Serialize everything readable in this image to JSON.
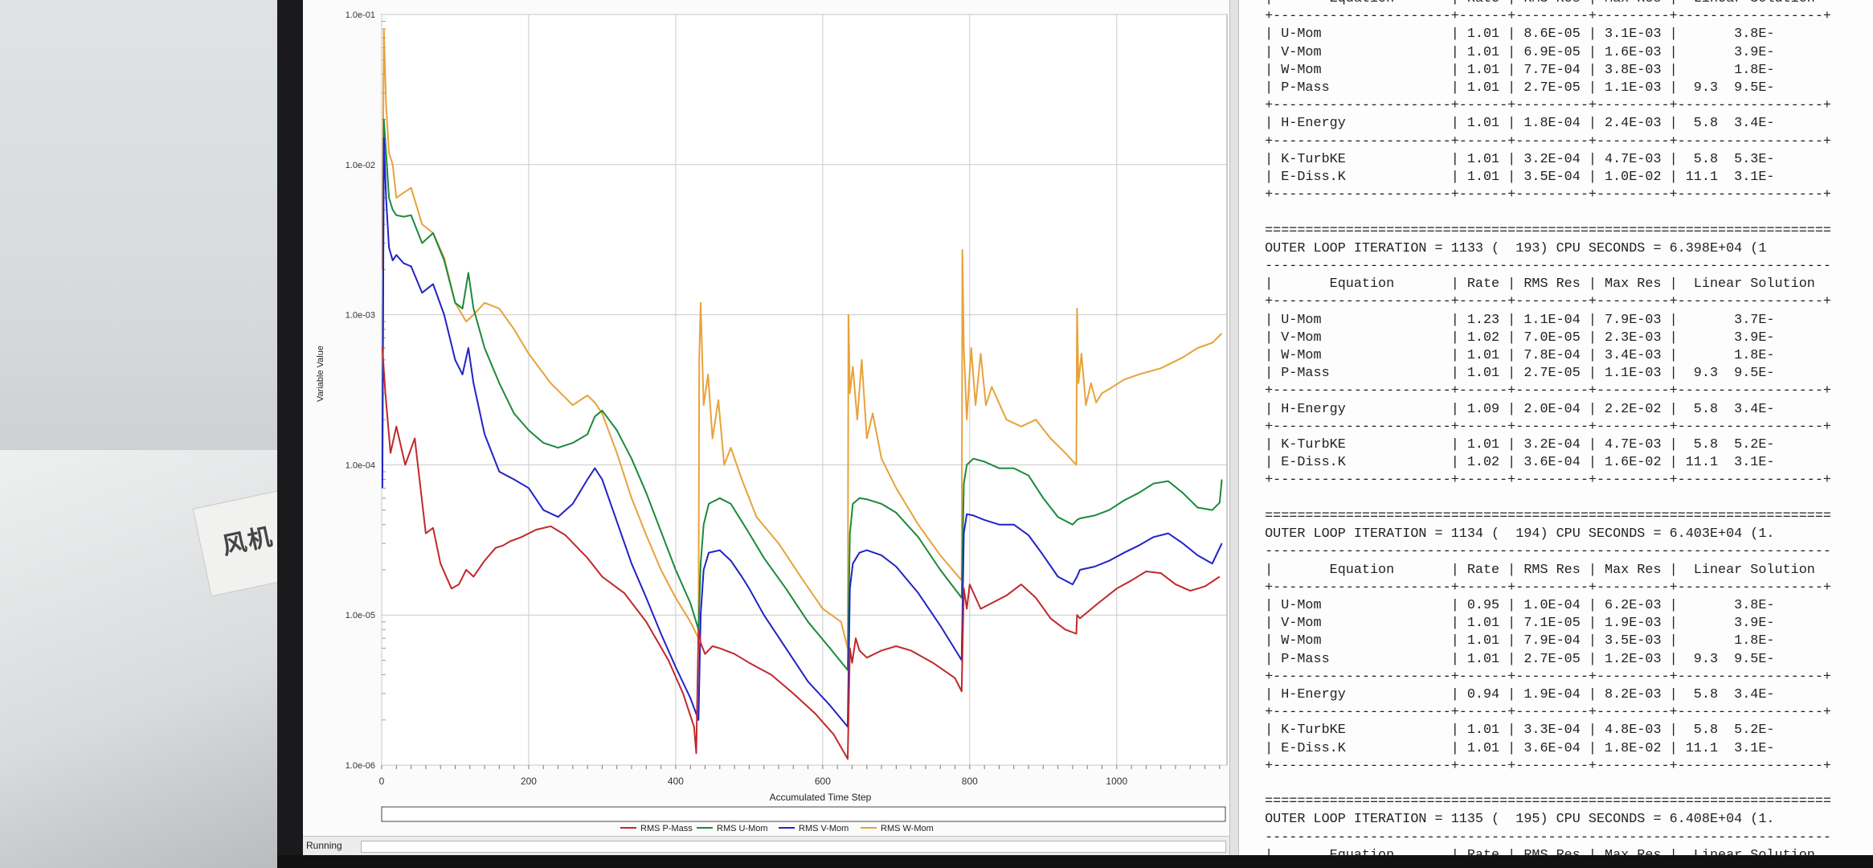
{
  "surroundings": {
    "paper_label": "风机"
  },
  "window": {
    "status": "Running"
  },
  "chart_data": {
    "type": "line",
    "xlabel": "Accumulated Time Step",
    "ylabel": "Variable Value",
    "log_y": true,
    "xlim": [
      0,
      1150
    ],
    "ylim": [
      1e-06,
      0.1
    ],
    "x_ticks": [
      "0",
      "200",
      "400",
      "600",
      "800",
      "1000"
    ],
    "y_ticks": [
      "1.0e-06",
      "1.0e-05",
      "1.0e-04",
      "1.0e-03",
      "1.0e-02",
      "1.0e-01"
    ],
    "grid": true,
    "legend_position": "bottom",
    "series": [
      {
        "name": "RMS P-Mass",
        "color": "#c0282c",
        "x": [
          1,
          5,
          12,
          20,
          32,
          45,
          60,
          70,
          80,
          95,
          105,
          115,
          125,
          140,
          155,
          165,
          175,
          190,
          210,
          230,
          250,
          280,
          300,
          330,
          360,
          390,
          410,
          425,
          428,
          431,
          434,
          440,
          450,
          460,
          480,
          500,
          530,
          560,
          590,
          615,
          634,
          637,
          640,
          645,
          650,
          660,
          680,
          700,
          720,
          750,
          780,
          789,
          792,
          796,
          800,
          815,
          830,
          850,
          870,
          890,
          910,
          930,
          945,
          946,
          950,
          975,
          1000,
          1020,
          1040,
          1060,
          1080,
          1100,
          1120,
          1140
        ],
        "y": [
          0.0006,
          0.0003,
          0.00012,
          0.00018,
          0.0001,
          0.00015,
          3.5e-05,
          3.8e-05,
          2.2e-05,
          1.5e-05,
          1.6e-05,
          2e-05,
          1.8e-05,
          2.3e-05,
          2.8e-05,
          2.9e-05,
          3.1e-05,
          3.3e-05,
          3.7e-05,
          3.9e-05,
          3.4e-05,
          2.4e-05,
          1.8e-05,
          1.4e-05,
          9e-06,
          5e-06,
          3e-06,
          1.8e-06,
          1.2e-06,
          8e-06,
          6.5e-06,
          5.5e-06,
          6.2e-06,
          6e-06,
          5.5e-06,
          4.8e-06,
          4e-06,
          3e-06,
          2.2e-06,
          1.6e-06,
          1.1e-06,
          6e-06,
          4.8e-06,
          7e-06,
          5.8e-06,
          5.2e-06,
          5.8e-06,
          6.2e-06,
          5.8e-06,
          4.8e-06,
          3.8e-06,
          3.1e-06,
          1.5e-05,
          1.1e-05,
          1.6e-05,
          1.1e-05,
          1.2e-05,
          1.35e-05,
          1.6e-05,
          1.3e-05,
          9.5e-06,
          8e-06,
          7.5e-06,
          1e-05,
          9.5e-06,
          1.2e-05,
          1.5e-05,
          1.7e-05,
          1.95e-05,
          1.9e-05,
          1.6e-05,
          1.45e-05,
          1.55e-05,
          1.8e-05
        ]
      },
      {
        "name": "RMS U-Mom",
        "color": "#1b8a3a",
        "x": [
          1,
          3,
          6,
          10,
          15,
          20,
          30,
          40,
          55,
          70,
          85,
          100,
          110,
          118,
          125,
          140,
          160,
          180,
          200,
          220,
          240,
          260,
          280,
          290,
          300,
          320,
          340,
          360,
          380,
          400,
          420,
          431,
          434,
          438,
          445,
          460,
          475,
          490,
          500,
          520,
          550,
          580,
          610,
          634,
          637,
          641,
          650,
          660,
          680,
          700,
          730,
          760,
          789,
          792,
          796,
          805,
          820,
          840,
          860,
          880,
          900,
          920,
          940,
          946,
          950,
          970,
          990,
          1010,
          1030,
          1050,
          1070,
          1090,
          1110,
          1130,
          1140,
          1143
        ],
        "y": [
          0.0001,
          0.02,
          0.012,
          0.006,
          0.005,
          0.0046,
          0.0045,
          0.0046,
          0.003,
          0.0035,
          0.0023,
          0.0012,
          0.0011,
          0.0019,
          0.0011,
          0.0006,
          0.00035,
          0.00022,
          0.00017,
          0.00014,
          0.00013,
          0.00014,
          0.00016,
          0.00021,
          0.00023,
          0.00017,
          0.00011,
          6.5e-05,
          3.6e-05,
          2e-05,
          1.2e-05,
          8e-06,
          2.2e-05,
          4e-05,
          5.5e-05,
          6e-05,
          5.5e-05,
          4.2e-05,
          3.5e-05,
          2.4e-05,
          1.5e-05,
          9e-06,
          6e-06,
          4.3e-06,
          3.5e-05,
          5.5e-05,
          6e-05,
          5.9e-05,
          5.5e-05,
          4.8e-05,
          3.3e-05,
          2e-05,
          1.3e-05,
          7.5e-05,
          0.0001,
          0.00011,
          0.000105,
          9.5e-05,
          9.5e-05,
          8.5e-05,
          6e-05,
          4.5e-05,
          4e-05,
          4.3e-05,
          4.4e-05,
          4.6e-05,
          5e-05,
          5.8e-05,
          6.5e-05,
          7.5e-05,
          7.8e-05,
          6.5e-05,
          5.2e-05,
          5e-05,
          5.6e-05,
          8e-05
        ]
      },
      {
        "name": "RMS V-Mom",
        "color": "#2222c8",
        "x": [
          1,
          3,
          6,
          10,
          15,
          20,
          30,
          40,
          55,
          70,
          85,
          100,
          110,
          118,
          125,
          140,
          160,
          180,
          200,
          220,
          240,
          260,
          280,
          290,
          300,
          320,
          340,
          360,
          380,
          400,
          420,
          431,
          434,
          438,
          445,
          460,
          475,
          490,
          500,
          520,
          550,
          580,
          610,
          634,
          637,
          641,
          650,
          660,
          680,
          700,
          730,
          760,
          789,
          792,
          796,
          805,
          820,
          840,
          860,
          880,
          900,
          920,
          940,
          946,
          950,
          970,
          990,
          1010,
          1030,
          1050,
          1070,
          1090,
          1110,
          1130,
          1143
        ],
        "y": [
          7e-05,
          0.015,
          0.006,
          0.0028,
          0.0023,
          0.0025,
          0.0022,
          0.0021,
          0.0014,
          0.0016,
          0.001,
          0.0005,
          0.0004,
          0.0006,
          0.00035,
          0.00016,
          9e-05,
          8e-05,
          7e-05,
          5e-05,
          4.5e-05,
          5.5e-05,
          8e-05,
          9.5e-05,
          8e-05,
          4.2e-05,
          2.2e-05,
          1.3e-05,
          7.5e-06,
          4.5e-06,
          2.8e-06,
          2e-06,
          1e-05,
          2e-05,
          2.6e-05,
          2.7e-05,
          2.3e-05,
          1.8e-05,
          1.5e-05,
          1e-05,
          6e-06,
          3.6e-06,
          2.5e-06,
          1.8e-06,
          1.5e-05,
          2.2e-05,
          2.6e-05,
          2.7e-05,
          2.5e-05,
          2.1e-05,
          1.4e-05,
          8.5e-06,
          5e-06,
          3.5e-05,
          4.7e-05,
          4.6e-05,
          4.3e-05,
          4e-05,
          4e-05,
          3.4e-05,
          2.5e-05,
          1.8e-05,
          1.6e-05,
          1.8e-05,
          2e-05,
          2.1e-05,
          2.3e-05,
          2.6e-05,
          2.9e-05,
          3.3e-05,
          3.5e-05,
          3e-05,
          2.5e-05,
          2.2e-05,
          3e-05
        ]
      },
      {
        "name": "RMS W-Mom",
        "color": "#e8a23a",
        "x": [
          1,
          3,
          6,
          10,
          15,
          20,
          30,
          40,
          55,
          70,
          85,
          100,
          115,
          125,
          140,
          160,
          180,
          200,
          230,
          260,
          280,
          290,
          300,
          320,
          340,
          360,
          380,
          400,
          420,
          431,
          432,
          434,
          438,
          444,
          450,
          458,
          466,
          475,
          490,
          510,
          540,
          570,
          600,
          625,
          634,
          635,
          637,
          641,
          647,
          653,
          660,
          668,
          680,
          700,
          730,
          760,
          789,
          790,
          792,
          796,
          802,
          808,
          815,
          822,
          830,
          850,
          870,
          890,
          910,
          930,
          945,
          946,
          948,
          952,
          958,
          965,
          972,
          980,
          990,
          1010,
          1030,
          1060,
          1090,
          1110,
          1130,
          1143
        ],
        "y": [
          0.002,
          0.08,
          0.025,
          0.012,
          0.01,
          0.006,
          0.0065,
          0.007,
          0.004,
          0.0035,
          0.0024,
          0.0012,
          0.0009,
          0.001,
          0.0012,
          0.0011,
          0.0008,
          0.00055,
          0.00035,
          0.00025,
          0.00029,
          0.00026,
          0.00022,
          0.00012,
          6e-05,
          3.4e-05,
          2e-05,
          1.3e-05,
          9e-06,
          7e-06,
          0.0005,
          0.0012,
          0.00025,
          0.0004,
          0.00015,
          0.00027,
          0.0001,
          0.00013,
          8e-05,
          4.5e-05,
          3e-05,
          1.8e-05,
          1.1e-05,
          9e-06,
          6e-06,
          0.001,
          0.0003,
          0.00045,
          0.0002,
          0.0005,
          0.00015,
          0.00022,
          0.00011,
          7e-05,
          4e-05,
          2.5e-05,
          1.7e-05,
          0.0027,
          0.0006,
          0.0002,
          0.0006,
          0.00025,
          0.00055,
          0.00025,
          0.00033,
          0.0002,
          0.00018,
          0.0002,
          0.00015,
          0.00012,
          0.0001,
          0.0011,
          0.00035,
          0.00055,
          0.00025,
          0.00035,
          0.00026,
          0.0003,
          0.00032,
          0.00037,
          0.0004,
          0.00044,
          0.00052,
          0.0006,
          0.00065,
          0.00075
        ]
      }
    ]
  },
  "solver_output": {
    "lines": [
      " |       Equation       | Rate | RMS Res | Max Res |  Linear Solution",
      " +----------------------+------+---------+---------+------------------+",
      " | U-Mom                | 1.01 | 8.6E-05 | 3.1E-03 |       3.8E-",
      " | V-Mom                | 1.01 | 6.9E-05 | 1.6E-03 |       3.9E-",
      " | W-Mom                | 1.01 | 7.7E-04 | 3.8E-03 |       1.8E-",
      " | P-Mass               | 1.01 | 2.7E-05 | 1.1E-03 |  9.3  9.5E-",
      " +----------------------+------+---------+---------+------------------+",
      " | H-Energy             | 1.01 | 1.8E-04 | 2.4E-03 |  5.8  3.4E-",
      " +----------------------+------+---------+---------+------------------+",
      " | K-TurbKE             | 1.01 | 3.2E-04 | 4.7E-03 |  5.8  5.3E-",
      " | E-Diss.K             | 1.01 | 3.5E-04 | 1.0E-02 | 11.1  3.1E-",
      " +----------------------+------+---------+---------+------------------+",
      "",
      " ======================================================================",
      " OUTER LOOP ITERATION = 1133 (  193) CPU SECONDS = 6.398E+04 (1",
      " ----------------------------------------------------------------------",
      " |       Equation       | Rate | RMS Res | Max Res |  Linear Solution",
      " +----------------------+------+---------+---------+------------------+",
      " | U-Mom                | 1.23 | 1.1E-04 | 7.9E-03 |       3.7E-",
      " | V-Mom                | 1.02 | 7.0E-05 | 2.3E-03 |       3.9E-",
      " | W-Mom                | 1.01 | 7.8E-04 | 3.4E-03 |       1.8E-",
      " | P-Mass               | 1.01 | 2.7E-05 | 1.1E-03 |  9.3  9.5E-",
      " +----------------------+------+---------+---------+------------------+",
      " | H-Energy             | 1.09 | 2.0E-04 | 2.2E-02 |  5.8  3.4E-",
      " +----------------------+------+---------+---------+------------------+",
      " | K-TurbKE             | 1.01 | 3.2E-04 | 4.7E-03 |  5.8  5.2E-",
      " | E-Diss.K             | 1.02 | 3.6E-04 | 1.6E-02 | 11.1  3.1E-",
      " +----------------------+------+---------+---------+------------------+",
      "",
      " ======================================================================",
      " OUTER LOOP ITERATION = 1134 (  194) CPU SECONDS = 6.403E+04 (1.",
      " ----------------------------------------------------------------------",
      " |       Equation       | Rate | RMS Res | Max Res |  Linear Solution",
      " +----------------------+------+---------+---------+------------------+",
      " | U-Mom                | 0.95 | 1.0E-04 | 6.2E-03 |       3.8E-",
      " | V-Mom                | 1.01 | 7.1E-05 | 1.9E-03 |       3.9E-",
      " | W-Mom                | 1.01 | 7.9E-04 | 3.5E-03 |       1.8E-",
      " | P-Mass               | 1.01 | 2.7E-05 | 1.2E-03 |  9.3  9.5E-",
      " +----------------------+------+---------+---------+------------------+",
      " | H-Energy             | 0.94 | 1.9E-04 | 8.2E-03 |  5.8  3.4E-",
      " +----------------------+------+---------+---------+------------------+",
      " | K-TurbKE             | 1.01 | 3.3E-04 | 4.8E-03 |  5.8  5.2E-",
      " | E-Diss.K             | 1.01 | 3.6E-04 | 1.8E-02 | 11.1  3.1E-",
      " +----------------------+------+---------+---------+------------------+",
      "",
      " ======================================================================",
      " OUTER LOOP ITERATION = 1135 (  195) CPU SECONDS = 6.408E+04 (1.",
      " ----------------------------------------------------------------------",
      " |       Equation       | Rate | RMS Res | Max Res |  Linear Solution"
    ]
  }
}
